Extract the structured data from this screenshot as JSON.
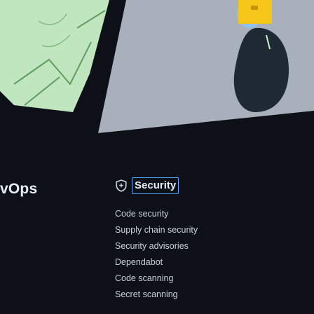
{
  "nav": {
    "partial_label": "vOps"
  },
  "security_menu": {
    "title": "Security",
    "icon": "shield-icon",
    "items": [
      {
        "label": "Code security"
      },
      {
        "label": "Supply chain security"
      },
      {
        "label": "Security advisories"
      },
      {
        "label": "Dependabot"
      },
      {
        "label": "Code scanning"
      },
      {
        "label": "Secret scanning"
      }
    ]
  },
  "colors": {
    "background": "#0d1117",
    "accent_blue": "#58a6ff",
    "yellow": "#f5c518",
    "text": "#e6edf3"
  }
}
